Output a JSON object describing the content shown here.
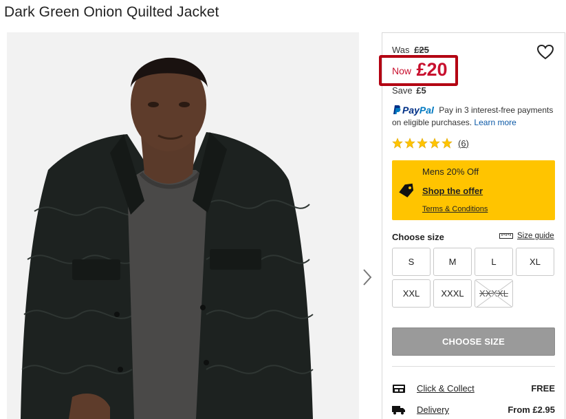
{
  "product": {
    "title": "Dark Green Onion Quilted Jacket"
  },
  "gallery": {
    "image_alt": "Model wearing dark green quilted jacket over grey jumper",
    "next_icon": "chevron-right-icon"
  },
  "pricing": {
    "was_label": "Was",
    "was_price": "£25",
    "now_label": "Now",
    "now_price": "£20",
    "save_label": "Save",
    "save_amount": "£5",
    "highlight_color": "#b30012",
    "price_color": "#c8102e"
  },
  "paypal": {
    "logo_text_1": "Pay",
    "logo_text_2": "Pal",
    "text": "Pay in 3 interest-free payments on eligible purchases.",
    "learn_more": "Learn more"
  },
  "rating": {
    "stars": 5,
    "count": "(6)",
    "star_color": "#ffc400"
  },
  "offer": {
    "title": "Mens 20% Off",
    "link": "Shop the offer",
    "terms": "Terms & Conditions",
    "background": "#ffc400"
  },
  "size_selector": {
    "label": "Choose size",
    "guide_label": "Size guide",
    "sizes": [
      {
        "label": "S",
        "available": true
      },
      {
        "label": "M",
        "available": true
      },
      {
        "label": "L",
        "available": true
      },
      {
        "label": "XL",
        "available": true
      },
      {
        "label": "XXL",
        "available": true
      },
      {
        "label": "XXXL",
        "available": true
      },
      {
        "label": "XXXXL",
        "available": false
      }
    ]
  },
  "cta": {
    "label": "CHOOSE SIZE"
  },
  "delivery": [
    {
      "icon": "click-collect-icon",
      "label": "Click & Collect",
      "value": "FREE"
    },
    {
      "icon": "delivery-truck-icon",
      "label": "Delivery",
      "value": "From £2.95"
    }
  ]
}
